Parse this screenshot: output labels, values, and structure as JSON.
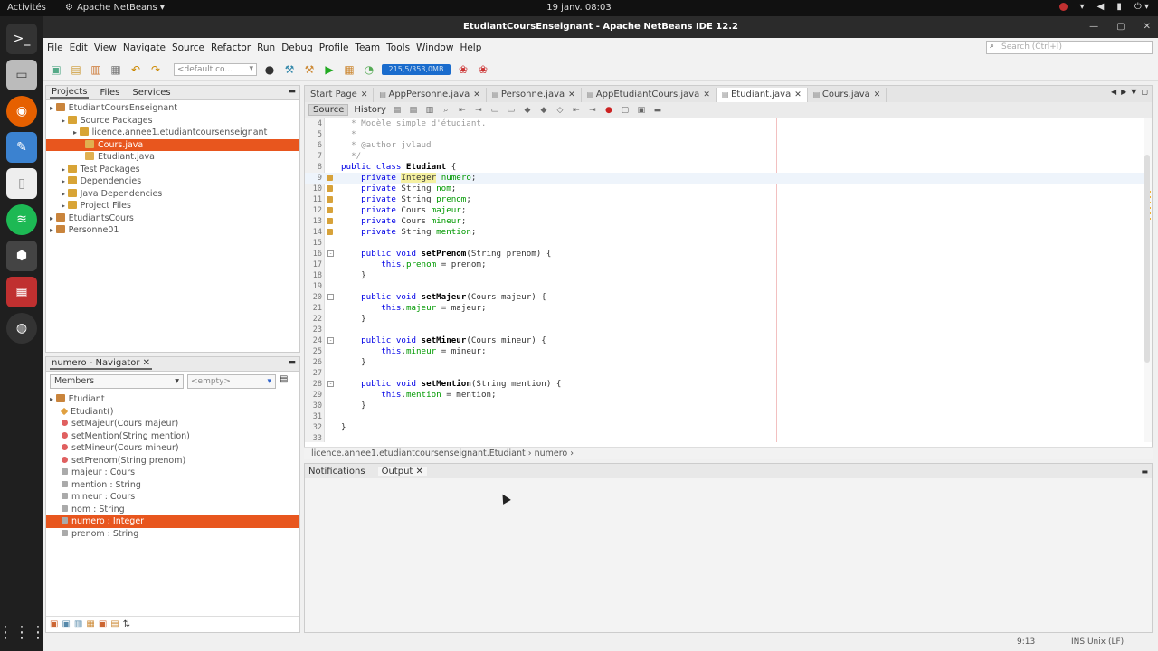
{
  "topbar": {
    "activities": "Activités",
    "app": "Apache NetBeans ▾",
    "clock": "19 janv.  08:03"
  },
  "window": {
    "title": "EtudiantCoursEnseignant - Apache NetBeans IDE 12.2"
  },
  "menu": [
    "File",
    "Edit",
    "View",
    "Navigate",
    "Source",
    "Refactor",
    "Run",
    "Debug",
    "Profile",
    "Team",
    "Tools",
    "Window",
    "Help"
  ],
  "search_placeholder": "Search (Ctrl+I)",
  "toolbar": {
    "config": "<default co...",
    "memory": "215,5/353,0MB"
  },
  "projects_panel": {
    "tabs": [
      "Projects",
      "Files",
      "Services"
    ],
    "tree": [
      {
        "label": "EtudiantCoursEnseignant",
        "indent": 0,
        "kind": "proj"
      },
      {
        "label": "Source Packages",
        "indent": 1,
        "kind": "fold"
      },
      {
        "label": "licence.annee1.etudiantcoursenseignant",
        "indent": 2,
        "kind": "fold"
      },
      {
        "label": "Cours.java",
        "indent": 3,
        "kind": "jav",
        "selected": true
      },
      {
        "label": "Etudiant.java",
        "indent": 3,
        "kind": "jav"
      },
      {
        "label": "Test Packages",
        "indent": 1,
        "kind": "fold"
      },
      {
        "label": "Dependencies",
        "indent": 1,
        "kind": "fold"
      },
      {
        "label": "Java Dependencies",
        "indent": 1,
        "kind": "fold"
      },
      {
        "label": "Project Files",
        "indent": 1,
        "kind": "fold"
      },
      {
        "label": "EtudiantsCours",
        "indent": 0,
        "kind": "proj"
      },
      {
        "label": "Personne01",
        "indent": 0,
        "kind": "proj"
      }
    ]
  },
  "navigator": {
    "title": "numero - Navigator",
    "filter": "Members",
    "filter2": "<empty>",
    "items": [
      {
        "label": "Etudiant",
        "indent": 0,
        "kind": "proj"
      },
      {
        "label": "Etudiant()",
        "indent": 1,
        "kind": "mor"
      },
      {
        "label": "setMajeur(Cours majeur)",
        "indent": 1,
        "kind": "mred"
      },
      {
        "label": "setMention(String mention)",
        "indent": 1,
        "kind": "mred"
      },
      {
        "label": "setMineur(Cours mineur)",
        "indent": 1,
        "kind": "mred"
      },
      {
        "label": "setPrenom(String prenom)",
        "indent": 1,
        "kind": "mred"
      },
      {
        "label": "majeur : Cours",
        "indent": 1,
        "kind": "mfld"
      },
      {
        "label": "mention : String",
        "indent": 1,
        "kind": "mfld"
      },
      {
        "label": "mineur : Cours",
        "indent": 1,
        "kind": "mfld"
      },
      {
        "label": "nom : String",
        "indent": 1,
        "kind": "mfld"
      },
      {
        "label": "numero : Integer",
        "indent": 1,
        "kind": "mfld",
        "selected": true
      },
      {
        "label": "prenom : String",
        "indent": 1,
        "kind": "mfld"
      }
    ]
  },
  "editor": {
    "tabs": [
      {
        "label": "Start Page",
        "closable": true
      },
      {
        "label": "AppPersonne.java",
        "closable": true
      },
      {
        "label": "Personne.java",
        "closable": true
      },
      {
        "label": "AppEtudiantCours.java",
        "closable": true
      },
      {
        "label": "Etudiant.java",
        "closable": true,
        "selected": true
      },
      {
        "label": "Cours.java",
        "closable": true
      }
    ],
    "source_label": "Source",
    "history_label": "History",
    "breadcrumb": "licence.annee1.etudiantcoursenseignant.Etudiant  ›  numero  ›"
  },
  "output_panel": {
    "tabs": [
      "Notifications",
      "Output"
    ]
  },
  "status": {
    "position": "9:13",
    "mode": "INS  Unix (LF)"
  }
}
